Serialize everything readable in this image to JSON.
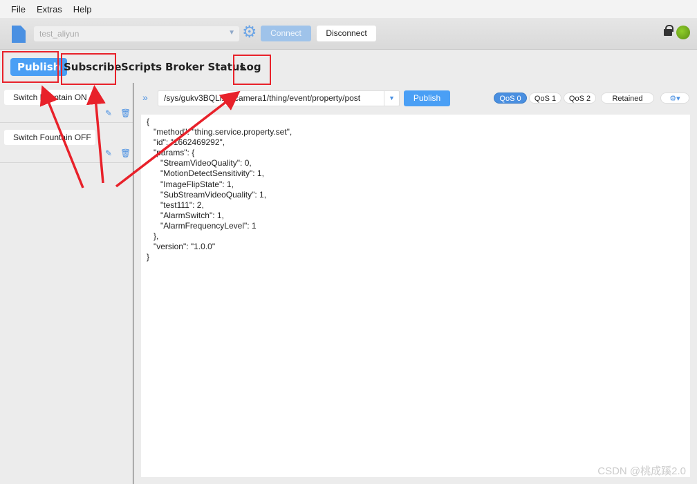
{
  "menu": [
    "File",
    "Extras",
    "Help"
  ],
  "toolbar": {
    "profile": "test_aliyun",
    "connect": "Connect",
    "disconnect": "Disconnect",
    "status_color": "#6fae1e"
  },
  "tabs": [
    "Publish",
    "Subscribe",
    "Scripts",
    "Broker Status",
    "Log"
  ],
  "scripts": [
    {
      "label": "Switch Fountain ON"
    },
    {
      "label": "Switch Fountain OFF"
    }
  ],
  "publish": {
    "topic": "/sys/gukv3BQLi1C/camera1/thing/event/property/post",
    "button": "Publish",
    "qos": [
      "QoS 0",
      "QoS 1",
      "QoS 2"
    ],
    "selected_qos": "QoS 0",
    "retained": "Retained",
    "payload": [
      "{",
      "   \"method\": \"thing.service.property.set\",",
      "   \"id\": \"1662469292\",",
      "   \"params\": {",
      "      \"StreamVideoQuality\": 0,",
      "      \"MotionDetectSensitivity\": 1,",
      "      \"ImageFlipState\": 1,",
      "      \"SubStreamVideoQuality\": 1,",
      "      \"test111\": 2,",
      "      \"AlarmSwitch\": 1,",
      "      \"AlarmFrequencyLevel\": 1",
      "   },",
      "   \"version\": \"1.0.0\"",
      "}"
    ]
  },
  "watermark": "CSDN @桃成蹊2.0",
  "annotation_color": "#e8212a"
}
